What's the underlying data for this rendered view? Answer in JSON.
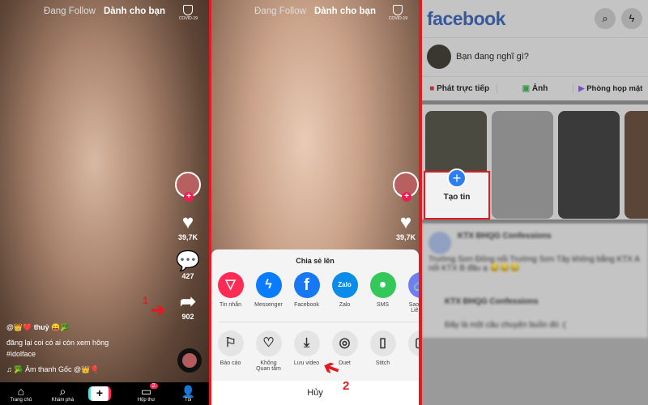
{
  "tiktok_feed": {
    "tabs": [
      "Đang Follow",
      "Dành cho bạn"
    ],
    "covid_label": "COVID-19",
    "likes": "39,7K",
    "comments": "427",
    "shares": "902",
    "step_marker": "1",
    "username": "@👑❤️ thuỷ 😛🥦",
    "description": "đăng lại coi có ai còn xem hông",
    "hashtag": "#idolface",
    "music": "🥦 Âm thanh Gốc   @👑🎈",
    "nav": [
      {
        "label": "Trang chủ",
        "icon": "home-icon"
      },
      {
        "label": "Khám phá",
        "icon": "search-icon"
      },
      {
        "label": "",
        "icon": "plus-icon"
      },
      {
        "label": "Hộp thư",
        "icon": "inbox-icon",
        "badge": "2"
      },
      {
        "label": "Tôi",
        "icon": "profile-icon"
      }
    ]
  },
  "tiktok_share": {
    "tabs": [
      "Đang Follow",
      "Dành cho bạn"
    ],
    "covid_label": "COVID-19",
    "likes": "39,7K",
    "sheet_title": "Chia sẻ lên",
    "share_targets": [
      {
        "label": "Tin nhắn",
        "color": "#fe2c55"
      },
      {
        "label": "Messenger",
        "color": "#0a7cff"
      },
      {
        "label": "Facebook",
        "color": "#1877f2"
      },
      {
        "label": "Zalo",
        "color": "#0a8ce8"
      },
      {
        "label": "SMS",
        "color": "#34c759"
      },
      {
        "label": "Sao chép Liên kết",
        "color": "#6f7ff0"
      }
    ],
    "actions": [
      {
        "label": "Báo cáo",
        "icon": "flag-icon"
      },
      {
        "label": "Không Quan tâm",
        "icon": "broken-heart-icon"
      },
      {
        "label": "Lưu video",
        "icon": "download-icon"
      },
      {
        "label": "Duet",
        "icon": "duet-icon"
      },
      {
        "label": "Stitch",
        "icon": "stitch-icon"
      },
      {
        "label": "R",
        "icon": "more-icon"
      }
    ],
    "cancel": "Hủy",
    "step_marker": "2"
  },
  "facebook": {
    "logo": "facebook",
    "composer_placeholder": "Bạn đang nghĩ gì?",
    "actions": [
      "Phát trực tiếp",
      "Ảnh",
      "Phòng họp mặt"
    ],
    "create_story": "Tạo tin",
    "posts": [
      {
        "author": "KTX ĐHQG Confessions",
        "text": "Trường Sơn Đông nối Trường Sơn Tây không bằng KTX A nối KTX B đâu ạ 😂😂😂"
      },
      {
        "author": "KTX ĐHQG Confessions",
        "text": "Đây là một câu chuyện buồn đó :("
      }
    ]
  },
  "colors": {
    "tiktok_red": "#fe2c55",
    "highlight_red": "#e01b22",
    "facebook_blue": "#38589a"
  }
}
